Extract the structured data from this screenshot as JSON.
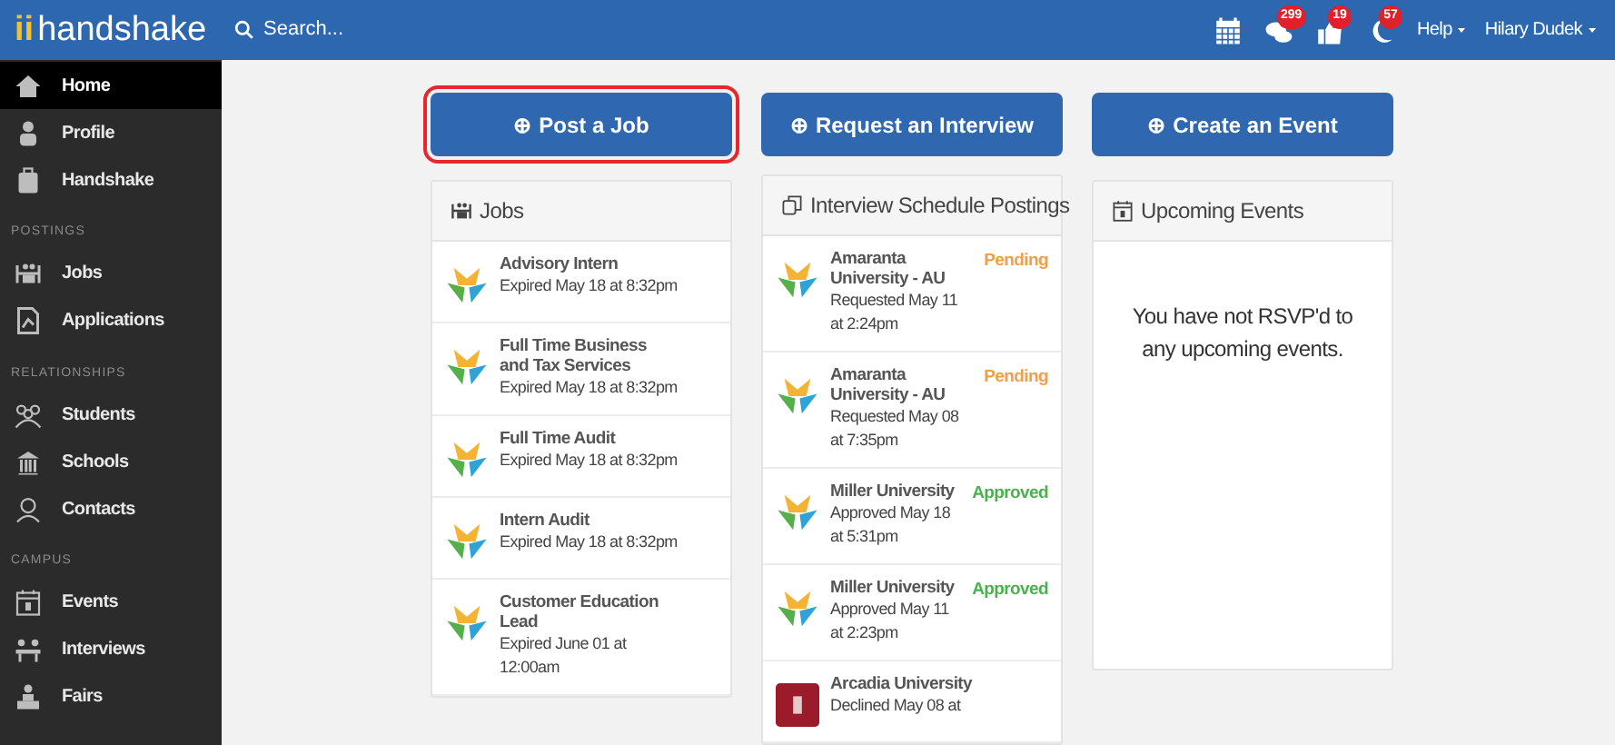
{
  "topbar": {
    "logo_mark": "ii",
    "logo_text": "handshake",
    "search": {
      "placeholder": "Search..."
    },
    "badges": [
      {
        "kind": "calendar"
      },
      {
        "kind": "chat",
        "count": "299"
      },
      {
        "kind": "thumb",
        "count": "19"
      },
      {
        "kind": "moon",
        "count": "57"
      }
    ],
    "menus": [
      "Help",
      "Hilary Dudek"
    ]
  },
  "sidebar": {
    "items": [
      {
        "kind": "item",
        "label": "Home",
        "selected": true
      },
      {
        "kind": "item",
        "label": "Profile",
        "selected": false
      },
      {
        "kind": "item",
        "label": "Handshake",
        "selected": false
      },
      {
        "kind": "heading",
        "label": "POSTINGS"
      },
      {
        "kind": "item",
        "label": "Jobs",
        "selected": false
      },
      {
        "kind": "item",
        "label": "Applications",
        "selected": false
      },
      {
        "kind": "heading",
        "label": "RELATIONSHIPS"
      },
      {
        "kind": "item",
        "label": "Students",
        "selected": false
      },
      {
        "kind": "item",
        "label": "Schools",
        "selected": false
      },
      {
        "kind": "item",
        "label": "Contacts",
        "selected": false
      },
      {
        "kind": "heading",
        "label": "CAMPUS"
      },
      {
        "kind": "item",
        "label": "Events",
        "selected": false
      },
      {
        "kind": "item",
        "label": "Interviews",
        "selected": false
      },
      {
        "kind": "item",
        "label": "Fairs",
        "selected": false
      }
    ]
  },
  "columns": [
    {
      "button": {
        "icon": "⊕",
        "label": "Post a Job",
        "highlighted": true
      },
      "card": {
        "title": "Jobs",
        "items": [
          {
            "kind": "star",
            "title": "Advisory Intern",
            "detail": "Expired May 18 at 8:32pm"
          },
          {
            "kind": "star",
            "title": "Full Time Business and Tax Services",
            "detail": "Expired May 18 at 8:32pm"
          },
          {
            "kind": "star",
            "title": "Full Time Audit",
            "detail": "Expired May 18 at 8:32pm"
          },
          {
            "kind": "star",
            "title": "Intern Audit",
            "detail": "Expired May 18 at 8:32pm"
          },
          {
            "kind": "star",
            "title": "Customer Education Lead",
            "detail": "Expired June 01 at 12:00am"
          }
        ]
      }
    },
    {
      "button": {
        "icon": "⊕",
        "label": "Request an Interview",
        "highlighted": false
      },
      "card": {
        "title": "Interview Schedule Postings",
        "items": [
          {
            "kind": "star",
            "title": "Amaranta University - AU",
            "detail": "Requested May 11 at 2:24pm",
            "status": "Pending",
            "color": "#f0a04b"
          },
          {
            "kind": "star",
            "title": "Amaranta University - AU",
            "detail": "Requested May 08 at 7:35pm",
            "status": "Pending",
            "color": "#f0a04b"
          },
          {
            "kind": "star",
            "title": "Miller University",
            "detail": "Approved May 18 at 5:31pm",
            "status": "Approved",
            "color": "#4caf50"
          },
          {
            "kind": "star",
            "title": "Miller University",
            "detail": "Approved May 11 at 2:23pm",
            "status": "Approved",
            "color": "#4caf50"
          },
          {
            "kind": "crest",
            "title": "Arcadia University",
            "detail": "Declined May 08 at"
          }
        ]
      }
    },
    {
      "button": {
        "icon": "⊕",
        "label": "Create an Event",
        "highlighted": false
      },
      "card": {
        "title": "Upcoming Events",
        "message": "You have not RSVP'd to any upcoming events."
      }
    }
  ]
}
